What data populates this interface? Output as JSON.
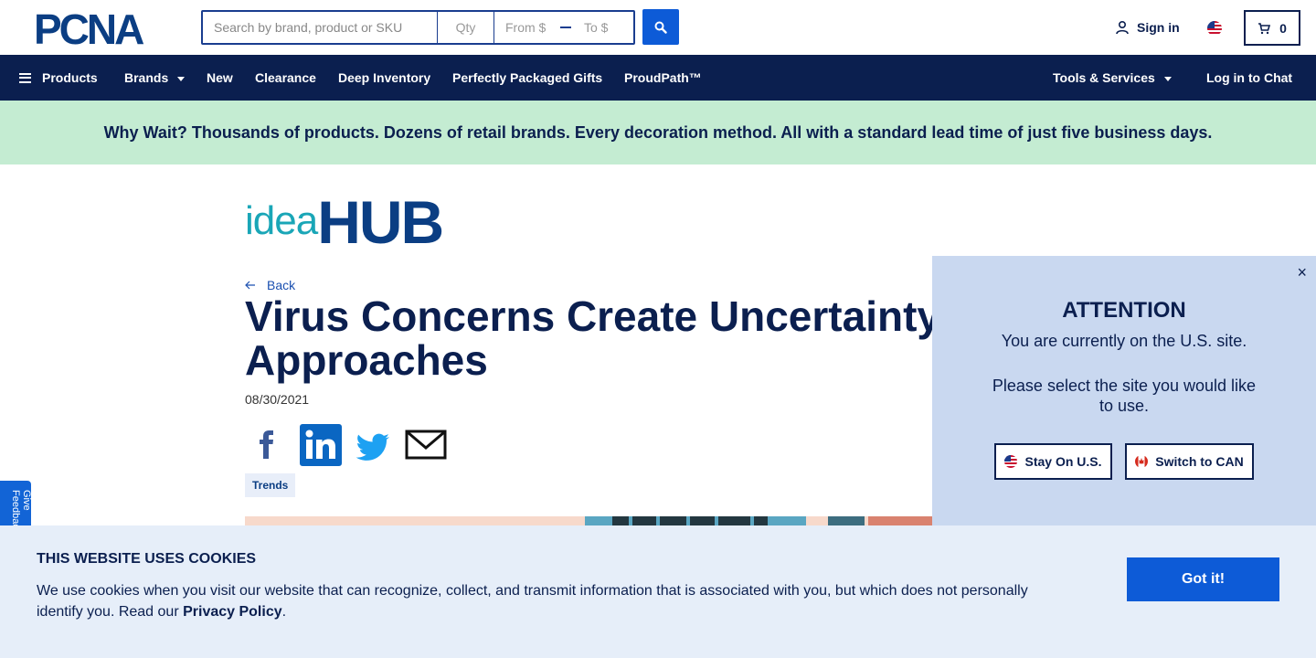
{
  "header": {
    "logo_text": "PCNA",
    "search_placeholder": "Search by brand, product or SKU",
    "qty_placeholder": "Qty",
    "from_placeholder": "From $",
    "to_placeholder": "To $",
    "sign_in": "Sign in",
    "cart_count": "0"
  },
  "nav": {
    "products": "Products",
    "brands": "Brands",
    "new": "New",
    "clearance": "Clearance",
    "deep_inventory": "Deep Inventory",
    "gifts": "Perfectly Packaged Gifts",
    "proudpath": "ProudPath™",
    "tools": "Tools & Services",
    "chat": "Log in to Chat"
  },
  "promo": "Why Wait? Thousands of products. Dozens of retail brands. Every decoration method. All with a standard lead time of just five business days.",
  "article": {
    "brand_idea": "idea",
    "brand_hub": "HUB",
    "back": "Back",
    "title": "Virus Concerns Create Uncertainty as Fall Approaches",
    "date": "08/30/2021",
    "tag": "Trends"
  },
  "feedback": "Give Feedback",
  "attention": {
    "title": "ATTENTION",
    "line1": "You are currently on the U.S. site.",
    "line2": "Please select the site you would like to use.",
    "stay": "Stay On U.S.",
    "switch": "Switch to CAN",
    "close": "×"
  },
  "cookies": {
    "title": "THIS WEBSITE USES COOKIES",
    "body": "We use cookies when you visit our website that can recognize, collect, and transmit information that is associated with you, but which does not personally identify you. Read our ",
    "link": "Privacy Policy",
    "end": ".",
    "button": "Got it!"
  },
  "colors": {
    "navy": "#0b1f4f",
    "blue": "#0d5bd7",
    "promo_bg": "#c4ecd2",
    "modal_bg": "#c9d8f0",
    "cookie_bg": "#e6eef9"
  }
}
